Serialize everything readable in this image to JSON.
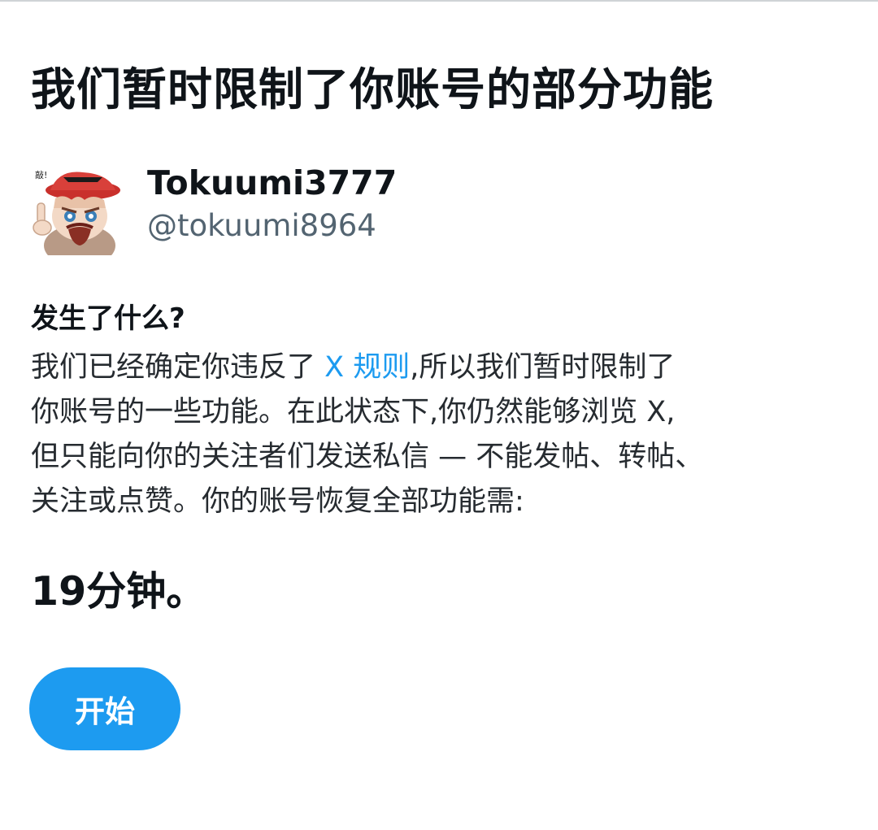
{
  "page": {
    "title": "我们暂时限制了你账号的部分功能"
  },
  "account": {
    "display_name": "Tokuumi3777",
    "handle": "@tokuumi8964",
    "avatar_caption": "敲!"
  },
  "notice": {
    "heading": "发生了什么?",
    "line1_before_link": "我们已经确定你违反了 ",
    "rules_link": "X 规则",
    "line1_after_link": ",所以我们暂时限制了",
    "line2": "你账号的一些功能。在此状态下,你仍然能够浏览 X,",
    "line3": "但只能向你的关注者们发送私信 — 不能发帖、转帖、",
    "line4": "关注或点赞。你的账号恢复全部功能需:"
  },
  "restriction": {
    "remaining_time": "19分钟。"
  },
  "actions": {
    "start_label": "开始"
  },
  "colors": {
    "accent": "#1d9bf0",
    "text_primary": "#0f1419",
    "text_secondary": "#536471"
  }
}
